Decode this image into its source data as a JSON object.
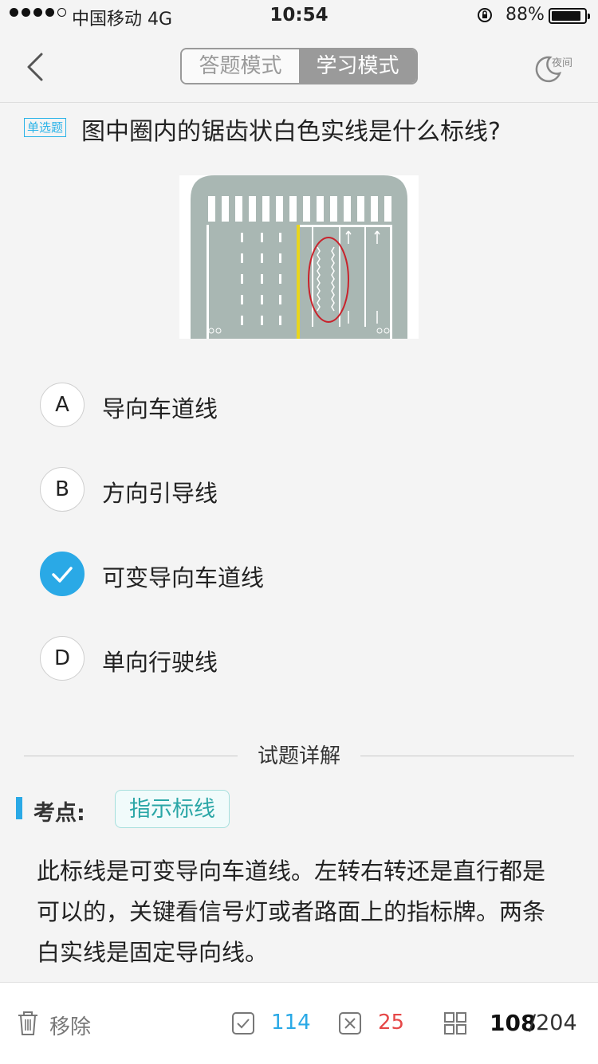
{
  "status": {
    "carrier": "中国移动  4G",
    "time": "10:54",
    "battery": "88%"
  },
  "nav": {
    "tab_answer": "答题模式",
    "tab_study": "学习模式",
    "night": "夜间"
  },
  "question": {
    "type": "单选题",
    "text": "图中圈内的锯齿状白色实线是什么标线?"
  },
  "options": [
    {
      "letter": "A",
      "text": "导向车道线",
      "selected": false
    },
    {
      "letter": "B",
      "text": "方向引导线",
      "selected": false
    },
    {
      "letter": "C",
      "text": "可变导向车道线",
      "selected": true
    },
    {
      "letter": "D",
      "text": "单向行驶线",
      "selected": false
    }
  ],
  "details": {
    "title": "试题详解",
    "keypoint_label": "考点:",
    "keypoint": "指示标线",
    "explanation": "此标线是可变导向车道线。左转右转还是直行都是可以的，关键看信号灯或者路面上的指标牌。两条白实线是固定导向线。"
  },
  "bottom": {
    "remove": "移除",
    "correct": "114",
    "wrong": "25",
    "current": "108",
    "total": "/204"
  },
  "colors": {
    "accent": "#2aa9e6",
    "wrong": "#e64848",
    "teal": "#2aa6a6"
  }
}
